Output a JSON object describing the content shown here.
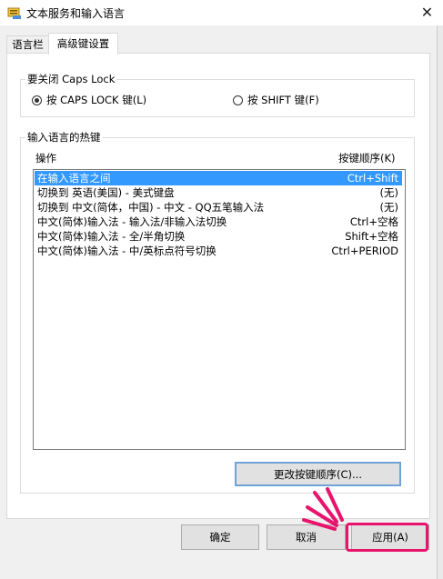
{
  "window": {
    "title": "文本服务和输入语言",
    "close_glyph": "✕"
  },
  "tabs": [
    {
      "label": "语言栏",
      "active": false
    },
    {
      "label": "高级键设置",
      "active": true
    }
  ],
  "caps_lock": {
    "legend": "要关闭 Caps Lock",
    "options": [
      {
        "label": "按 CAPS LOCK 键(L)",
        "checked": true
      },
      {
        "label": "按 SHIFT 键(F)",
        "checked": false
      }
    ]
  },
  "hotkeys": {
    "legend": "输入语言的热键",
    "columns": {
      "action": "操作",
      "key_sequence": "按键顺序(K)"
    },
    "rows": [
      {
        "action": "在输入语言之间",
        "keys": "Ctrl+Shift",
        "selected": true
      },
      {
        "action": "切换到 英语(美国) - 美式键盘",
        "keys": "(无)",
        "selected": false
      },
      {
        "action": "切换到 中文(简体，中国) - 中文 - QQ五笔输入法",
        "keys": "(无)",
        "selected": false
      },
      {
        "action": "中文(简体)输入法 - 输入法/非输入法切换",
        "keys": "Ctrl+空格",
        "selected": false
      },
      {
        "action": "中文(简体)输入法 - 全/半角切换",
        "keys": "Shift+空格",
        "selected": false
      },
      {
        "action": "中文(简体)输入法 - 中/英标点符号切换",
        "keys": "Ctrl+PERIOD",
        "selected": false
      }
    ],
    "change_button": "更改按键顺序(C)..."
  },
  "footer": {
    "ok": "确定",
    "cancel": "取消",
    "apply": "应用(A)"
  },
  "colors": {
    "selection": "#3399ff",
    "highlight": "#e8136c"
  },
  "icons": {
    "app": "keyboard-language-icon",
    "close": "close-icon"
  }
}
